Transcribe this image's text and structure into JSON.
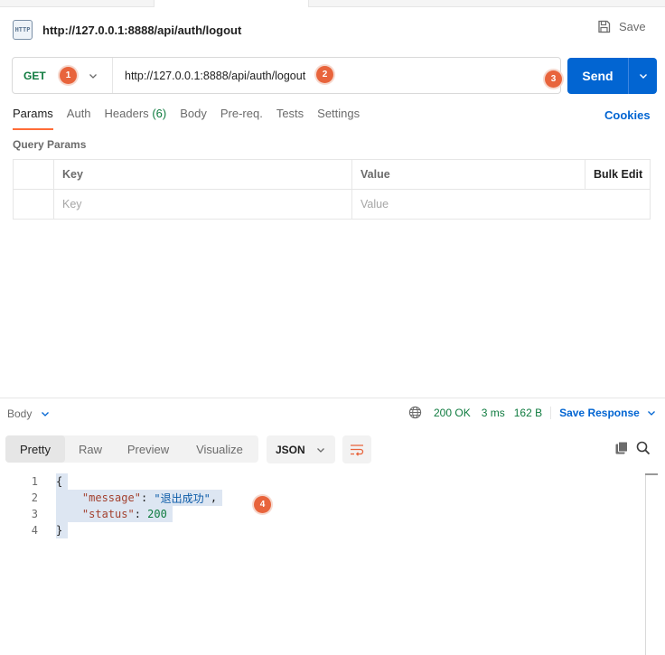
{
  "request": {
    "title": "http://127.0.0.1:8888/api/auth/logout",
    "save_label": "Save",
    "method": "GET",
    "url": "http://127.0.0.1:8888/api/auth/logout",
    "send_label": "Send"
  },
  "badges": [
    "1",
    "2",
    "3",
    "4"
  ],
  "tabs": [
    {
      "label": "Params",
      "active": true
    },
    {
      "label": "Auth"
    },
    {
      "label": "Headers",
      "count": "(6)"
    },
    {
      "label": "Body"
    },
    {
      "label": "Pre-req."
    },
    {
      "label": "Tests"
    },
    {
      "label": "Settings"
    }
  ],
  "cookies_label": "Cookies",
  "query_params": {
    "title": "Query Params",
    "headers": [
      "Key",
      "Value",
      "Bulk Edit"
    ],
    "placeholder_key": "Key",
    "placeholder_value": "Value"
  },
  "response": {
    "body_label": "Body",
    "status": "200 OK",
    "time": "3 ms",
    "size": "162 B",
    "save_response": "Save Response",
    "view_tabs": [
      "Pretty",
      "Raw",
      "Preview",
      "Visualize"
    ],
    "active_view": "Pretty",
    "format": "JSON",
    "lines": [
      "1",
      "2",
      "3",
      "4"
    ],
    "json": {
      "message_key": "\"message\"",
      "message_val": "\"退出成功\"",
      "status_key": "\"status\"",
      "status_val": "200"
    }
  },
  "colors": {
    "accent": "#ff6c37",
    "send": "#0265d2",
    "method_get": "#0f7b3f",
    "badge": "#e8643c"
  }
}
